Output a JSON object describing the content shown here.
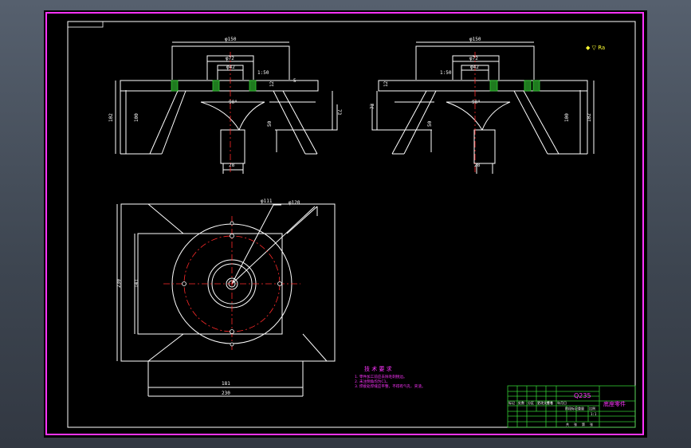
{
  "drawing": {
    "title_block": {
      "material": "Q235",
      "part_name": "底座零件",
      "labels": [
        "标记",
        "处数",
        "分区",
        "更改文件号",
        "签名",
        "年月日"
      ],
      "scale_row": [
        "阶段标记",
        "重量",
        "比例"
      ],
      "ratio": "1:1",
      "sheet_info": [
        "共",
        "张",
        "第",
        "张"
      ]
    },
    "notes": {
      "title": "技 术 要 求",
      "lines": [
        "1. 零件加工前应去除毛刺锐边。",
        "2. 未注倒角均为C1。",
        "3. 焊接处焊缝应平整，不得有气孔、夹渣。"
      ]
    },
    "roughness_note": "◆ ▽ Ra",
    "front_left": {
      "dims": {
        "top_width": "φ150",
        "inner": "φ72",
        "hole": "φ42",
        "height_total": "102",
        "height_2": "100",
        "height_right": "73",
        "angle": "90°",
        "slope": "1:50",
        "stub": "50",
        "base": "28",
        "plate": "12",
        "bolt": "5"
      }
    },
    "front_right": {
      "dims": {
        "top_width": "φ150",
        "inner": "φ72",
        "hole": "φ42",
        "height_total": "102",
        "height_2": "100",
        "height_left": "73",
        "angle": "90°",
        "slope": "1:50",
        "stub": "50",
        "base": "28",
        "plate": "12"
      }
    },
    "plan": {
      "dims": {
        "outer_dia": "φ120",
        "bolt_circle": "φ111",
        "height": "230",
        "height_inner": "141",
        "width_inner": "181",
        "width_total": "230"
      }
    },
    "colors": {
      "line": "#ffffff",
      "center": "#ff2a2a",
      "hatch": "#33cc33",
      "border": "#ff33ff",
      "table": "#33cc33"
    }
  }
}
